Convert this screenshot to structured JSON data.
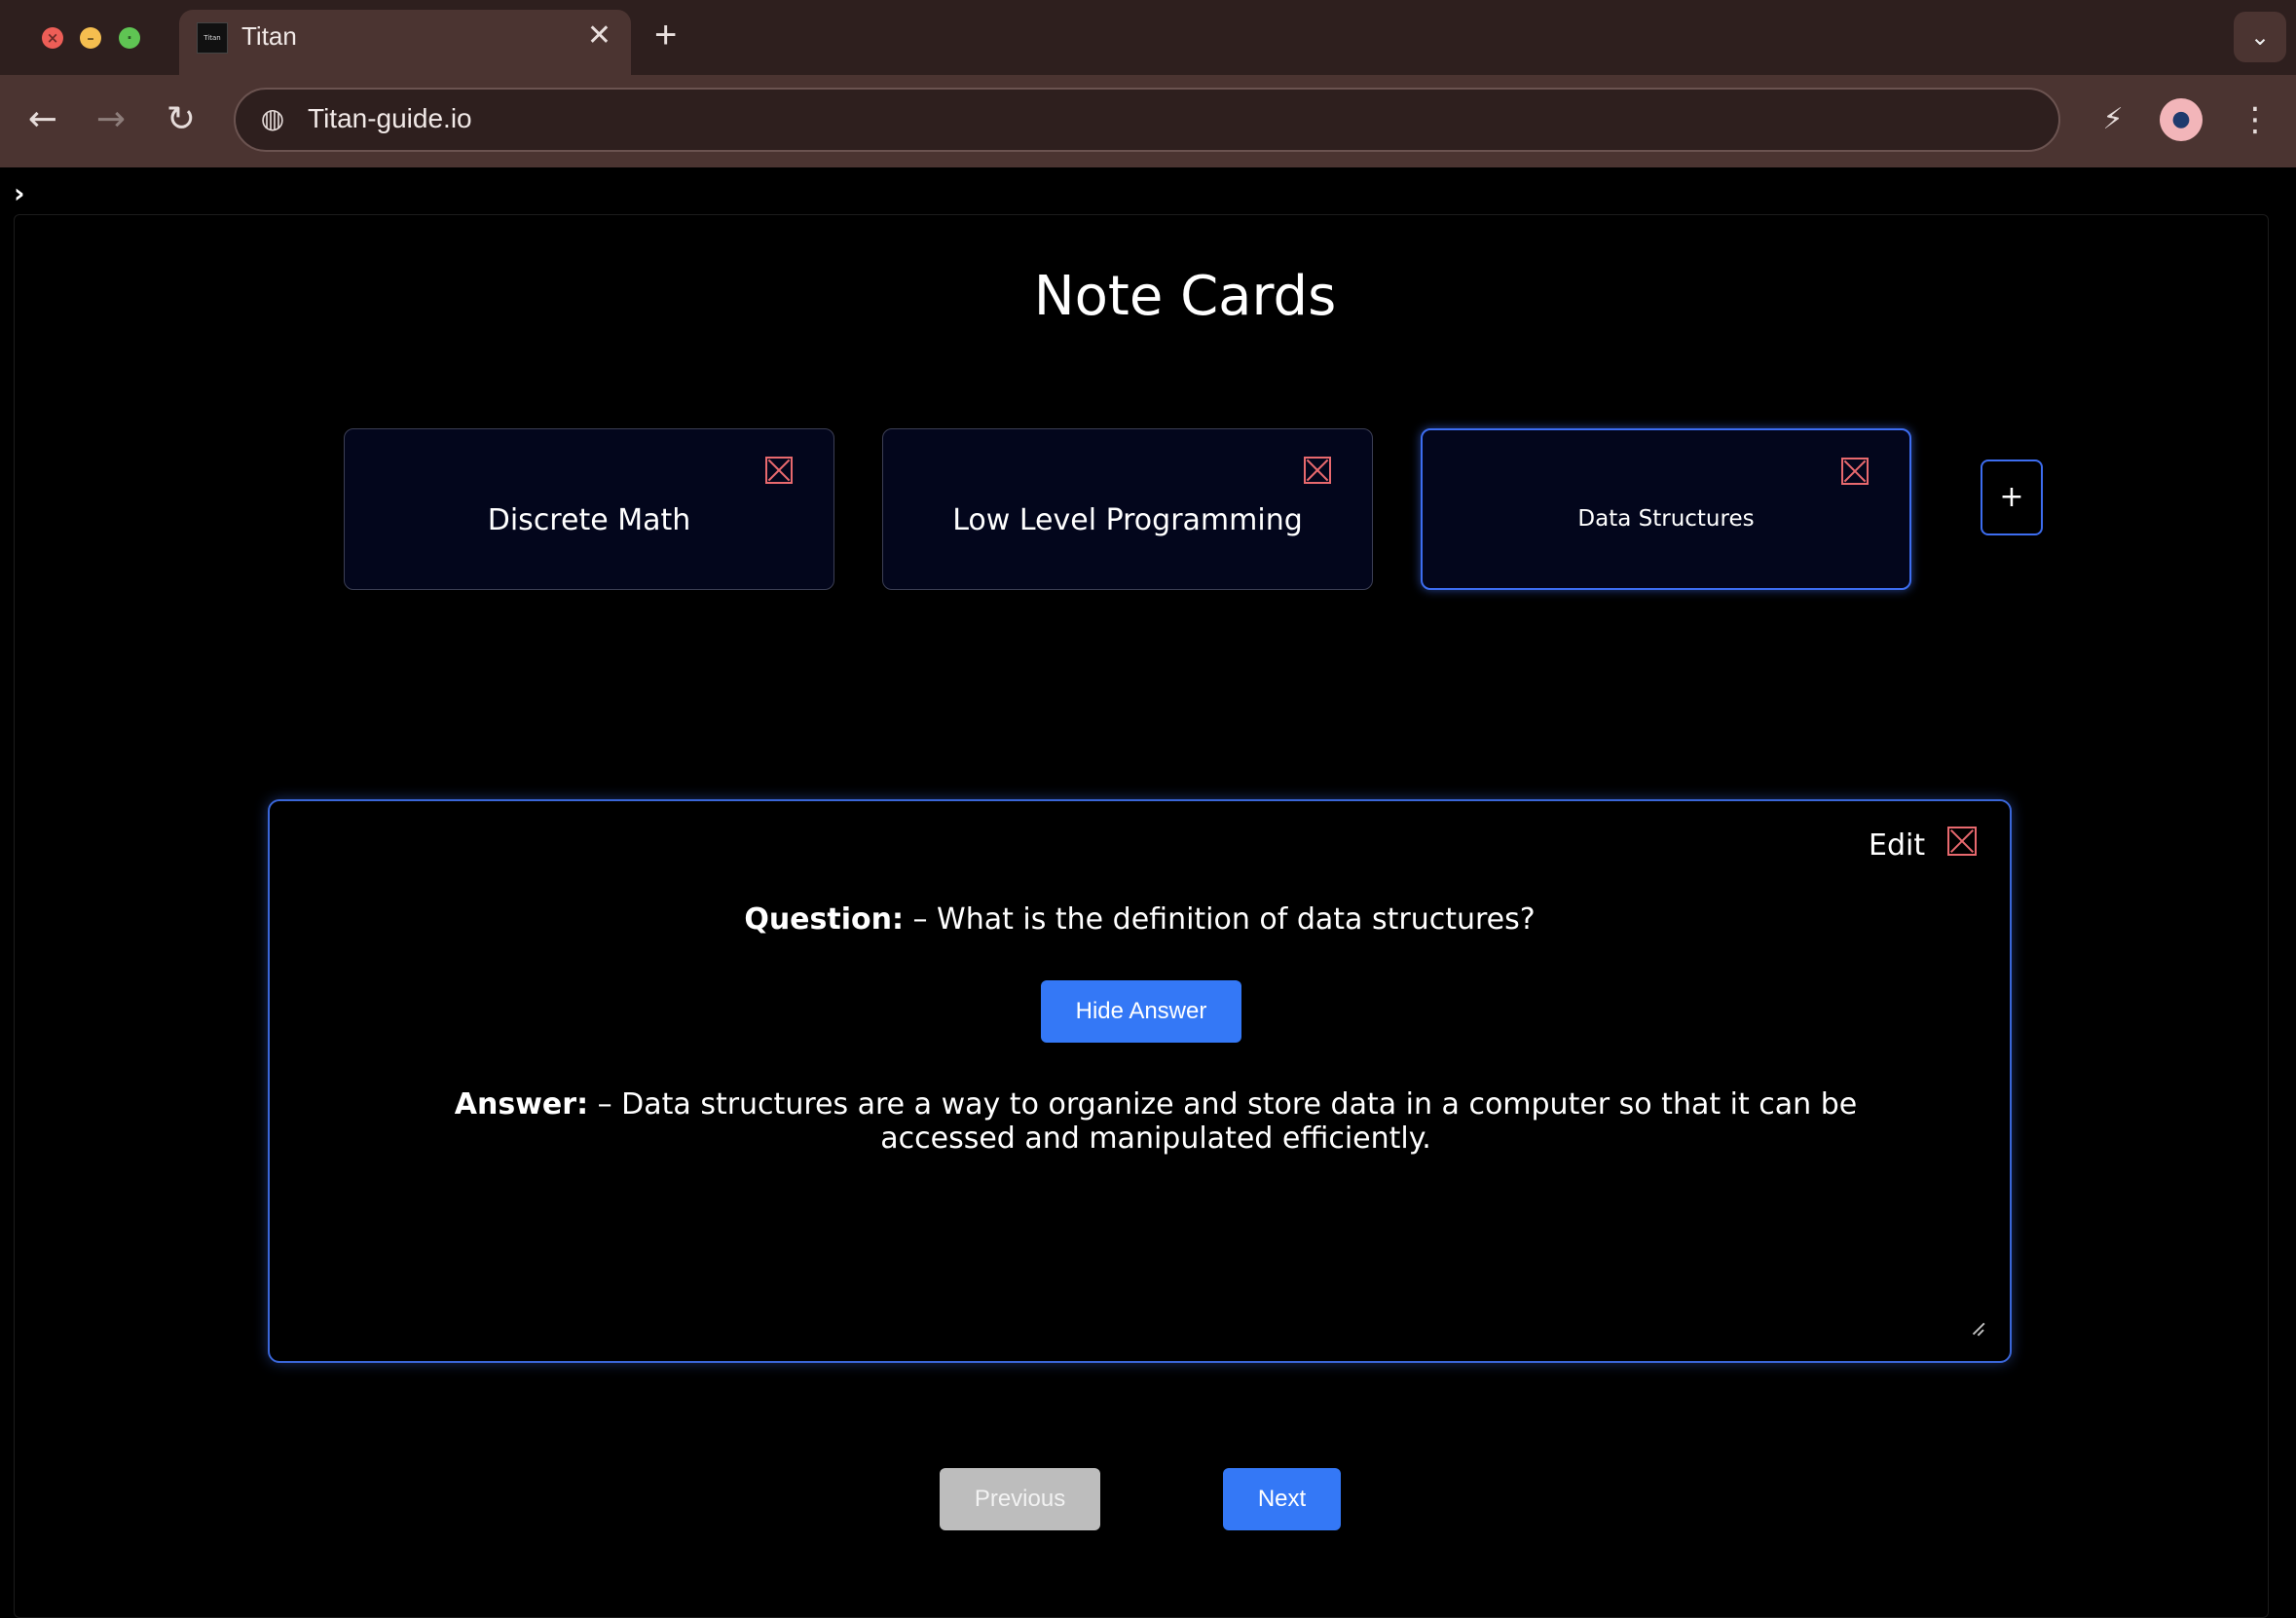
{
  "browser": {
    "tab_title": "Titan",
    "favicon_text": "Titan",
    "close_glyph": "✕",
    "new_tab_glyph": "+",
    "tab_menu_glyph": "⌄",
    "url": "Titan-guide.io",
    "back_glyph": "←",
    "forward_glyph": "→",
    "reload_glyph": "↻",
    "site_info_glyph": "◍",
    "extension_glyph": "⚡",
    "avatar_glyph": "●",
    "menu_glyph": "⋮"
  },
  "page": {
    "sidebar_toggle": "›",
    "title": "Note Cards"
  },
  "decks": [
    {
      "label": "Discrete Math",
      "active": false
    },
    {
      "label": "Low Level Programming",
      "active": false
    },
    {
      "label": "Data Structures",
      "active": true
    }
  ],
  "add_deck_label": "+",
  "card": {
    "edit_label": "Edit",
    "question_prefix": "Question:",
    "question_text": " – What is the definition of data structures?",
    "toggle_label": "Hide Answer",
    "answer_prefix": "Answer:",
    "answer_text": " – Data structures are a way to organize and store data in a computer so that it can be accessed and manipulated efficiently."
  },
  "navigation": {
    "previous_label": "Previous",
    "next_label": "Next"
  },
  "colors": {
    "accent": "#3478f6",
    "delete": "#e8696e",
    "disabled": "#bdbdbd",
    "deck_bg": "#03061c"
  }
}
